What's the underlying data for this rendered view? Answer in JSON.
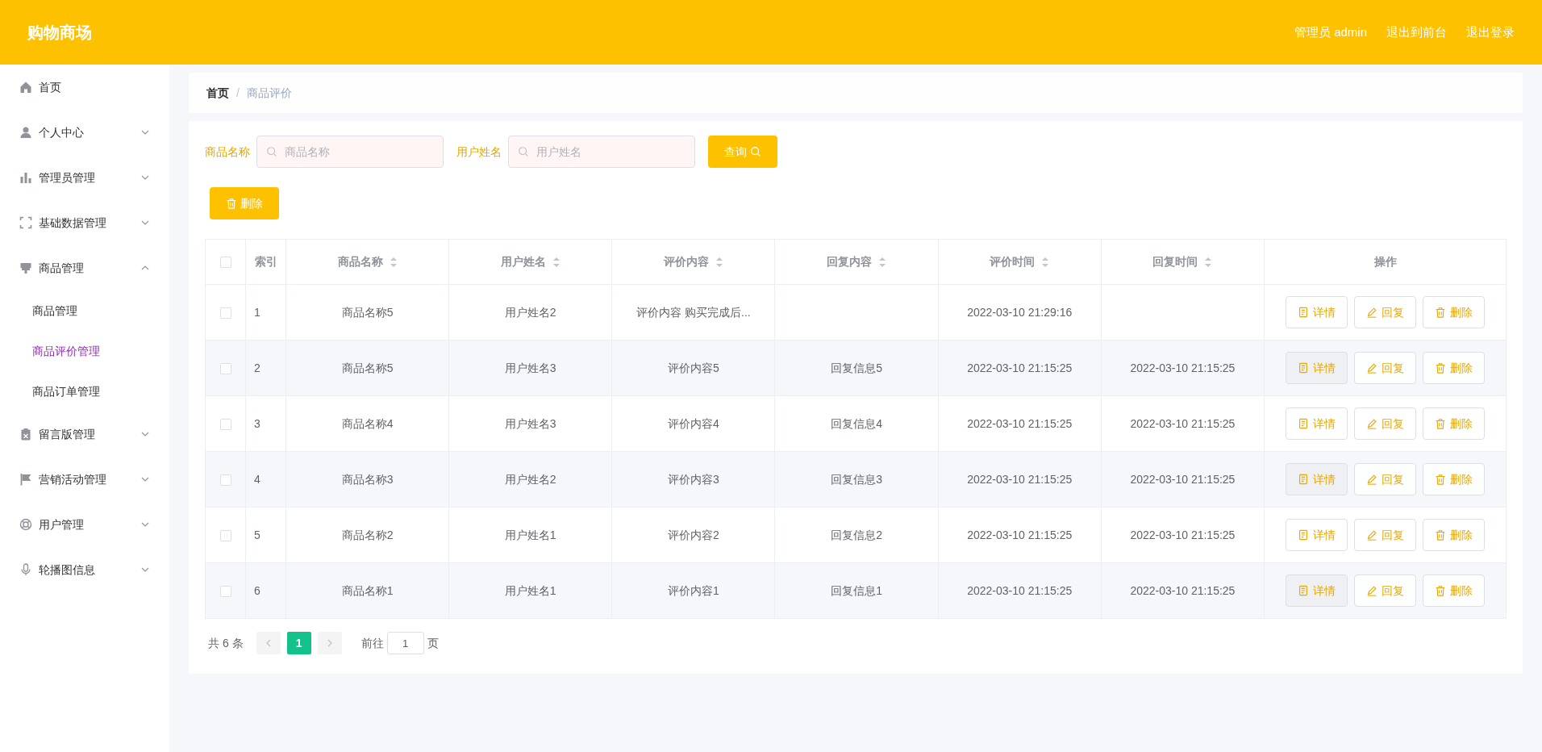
{
  "header": {
    "title": "购物商场",
    "links": [
      {
        "label": "管理员 admin"
      },
      {
        "label": "退出到前台"
      },
      {
        "label": "退出登录"
      }
    ]
  },
  "sidebar": {
    "items": [
      {
        "label": "首页",
        "has_children": false
      },
      {
        "label": "个人中心",
        "expanded": false,
        "has_children": true
      },
      {
        "label": "管理员管理",
        "expanded": false,
        "has_children": true
      },
      {
        "label": "基础数据管理",
        "expanded": false,
        "has_children": true
      },
      {
        "label": "商品管理",
        "expanded": true,
        "has_children": true,
        "children": [
          {
            "label": "商品管理",
            "selected": false
          },
          {
            "label": "商品评价管理",
            "selected": true
          },
          {
            "label": "商品订单管理",
            "selected": false
          }
        ]
      },
      {
        "label": "留言版管理",
        "expanded": false,
        "has_children": true
      },
      {
        "label": "营销活动管理",
        "expanded": false,
        "has_children": true
      },
      {
        "label": "用户管理",
        "expanded": false,
        "has_children": true
      },
      {
        "label": "轮播图信息",
        "expanded": false,
        "has_children": true
      }
    ]
  },
  "breadcrumb": {
    "separator": "/",
    "items": [
      {
        "label": "首页",
        "current": false
      },
      {
        "label": "商品评价",
        "current": true
      }
    ]
  },
  "search": {
    "fields": [
      {
        "label": "商品名称",
        "placeholder": "商品名称"
      },
      {
        "label": "用户姓名",
        "placeholder": "用户姓名"
      }
    ],
    "button": "查询"
  },
  "toolbar": {
    "delete_button": "删除"
  },
  "table": {
    "header_checked": false,
    "columns": [
      {
        "label": "索引",
        "sortable": false
      },
      {
        "label": "商品名称",
        "sortable": true
      },
      {
        "label": "用户姓名",
        "sortable": true
      },
      {
        "label": "评价内容",
        "sortable": true
      },
      {
        "label": "回复内容",
        "sortable": true
      },
      {
        "label": "评价时间",
        "sortable": true
      },
      {
        "label": "回复时间",
        "sortable": true
      },
      {
        "label": "操作",
        "sortable": false
      }
    ],
    "rows": [
      {
        "checked": false,
        "cells": [
          "1",
          "商品名称5",
          "用户姓名2",
          "评价内容 购买完成后...",
          "",
          "2022-03-10 21:29:16",
          ""
        ],
        "actions": [
          {
            "kind": "detail",
            "label": "详情"
          },
          {
            "kind": "reply",
            "label": "回复"
          },
          {
            "kind": "delete",
            "label": "删除"
          }
        ]
      },
      {
        "checked": false,
        "cells": [
          "2",
          "商品名称5",
          "用户姓名3",
          "评价内容5",
          "回复信息5",
          "2022-03-10 21:15:25",
          "2022-03-10 21:15:25"
        ],
        "actions": [
          {
            "kind": "detail",
            "label": "详情"
          },
          {
            "kind": "reply",
            "label": "回复"
          },
          {
            "kind": "delete",
            "label": "删除"
          }
        ]
      },
      {
        "checked": false,
        "cells": [
          "3",
          "商品名称4",
          "用户姓名3",
          "评价内容4",
          "回复信息4",
          "2022-03-10 21:15:25",
          "2022-03-10 21:15:25"
        ],
        "actions": [
          {
            "kind": "detail",
            "label": "详情"
          },
          {
            "kind": "reply",
            "label": "回复"
          },
          {
            "kind": "delete",
            "label": "删除"
          }
        ]
      },
      {
        "checked": false,
        "cells": [
          "4",
          "商品名称3",
          "用户姓名2",
          "评价内容3",
          "回复信息3",
          "2022-03-10 21:15:25",
          "2022-03-10 21:15:25"
        ],
        "actions": [
          {
            "kind": "detail",
            "label": "详情"
          },
          {
            "kind": "reply",
            "label": "回复"
          },
          {
            "kind": "delete",
            "label": "删除"
          }
        ]
      },
      {
        "checked": false,
        "cells": [
          "5",
          "商品名称2",
          "用户姓名1",
          "评价内容2",
          "回复信息2",
          "2022-03-10 21:15:25",
          "2022-03-10 21:15:25"
        ],
        "actions": [
          {
            "kind": "detail",
            "label": "详情"
          },
          {
            "kind": "reply",
            "label": "回复"
          },
          {
            "kind": "delete",
            "label": "删除"
          }
        ]
      },
      {
        "checked": false,
        "cells": [
          "6",
          "商品名称1",
          "用户姓名1",
          "评价内容1",
          "回复信息1",
          "2022-03-10 21:15:25",
          "2022-03-10 21:15:25"
        ],
        "actions": [
          {
            "kind": "detail",
            "label": "详情"
          },
          {
            "kind": "reply",
            "label": "回复"
          },
          {
            "kind": "delete",
            "label": "删除"
          }
        ]
      }
    ]
  },
  "pagination": {
    "total": "共 6 条",
    "pages": [
      {
        "label": "1",
        "selected": true
      }
    ],
    "goto_label": "前往",
    "goto_value": "1",
    "goto_suffix": "页"
  }
}
